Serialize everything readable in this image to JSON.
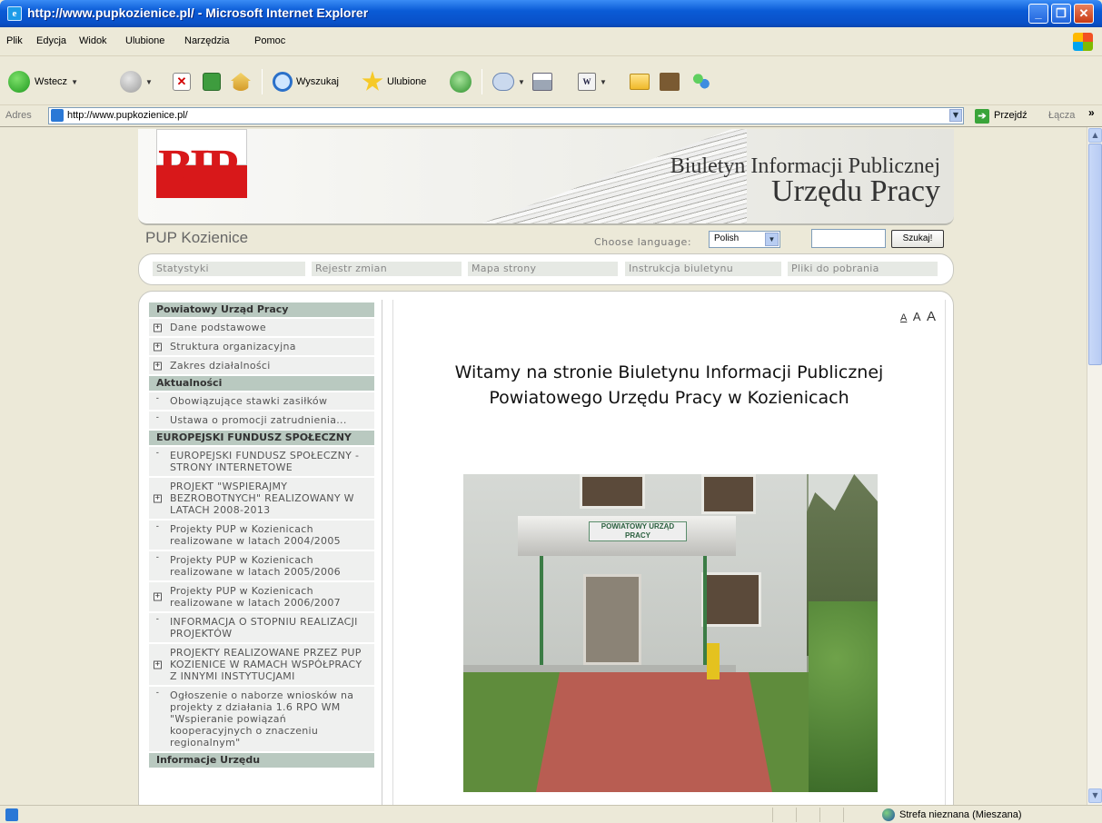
{
  "window": {
    "title": "http://www.pupkozienice.pl/ - Microsoft Internet Explorer",
    "app_icon": "ie-page-icon",
    "controls": [
      "minimize",
      "maximize",
      "close"
    ]
  },
  "menu": [
    "Plik",
    "Edycja",
    "Widok",
    "Ulubione",
    "Narzędzia",
    "Pomoc"
  ],
  "toolbar": {
    "back": "Wstecz",
    "search": "Wyszukaj",
    "favorites": "Ulubione"
  },
  "address": {
    "label": "Adres",
    "url": "http://www.pupkozienice.pl/",
    "go": "Przejdź",
    "links": "Łącza",
    "more": "»"
  },
  "banner": {
    "logo": "BIP",
    "line1": "Biuletyn Informacji Publicznej",
    "line2": "Urzędu Pracy"
  },
  "header": {
    "site_name": "PUP Kozienice",
    "language_label": "Choose language:",
    "language_value": "Polish",
    "search_value": "",
    "search_button": "Szukaj!"
  },
  "topnav": [
    "Statystyki",
    "Rejestr zmian",
    "Mapa strony",
    "Instrukcja biuletynu",
    "Pliki do pobrania"
  ],
  "sidebar": {
    "sections": [
      {
        "title": "Powiatowy Urząd Pracy",
        "items": [
          {
            "label": "Dane podstawowe",
            "mark": "plus"
          },
          {
            "label": "Struktura organizacyjna",
            "mark": "plus"
          },
          {
            "label": "Zakres działalności",
            "mark": "plus"
          }
        ]
      },
      {
        "title": "Aktualności",
        "items": [
          {
            "label": "Obowiązujące stawki zasiłków",
            "mark": "minus"
          },
          {
            "label": "Ustawa o promocji zatrudnienia...",
            "mark": "minus"
          }
        ]
      },
      {
        "title": "EUROPEJSKI FUNDUSZ SPOŁECZNY",
        "items": [
          {
            "label": "EUROPEJSKI FUNDUSZ SPOŁECZNY - STRONY INTERNETOWE",
            "mark": "minus"
          },
          {
            "label": "PROJEKT \"WSPIERAJMY BEZROBOTNYCH\" REALIZOWANY W LATACH 2008-2013",
            "mark": "plus"
          },
          {
            "label": "Projekty PUP w Kozienicach realizowane w latach 2004/2005",
            "mark": "minus"
          },
          {
            "label": "Projekty PUP w Kozienicach realizowane w latach 2005/2006",
            "mark": "minus"
          },
          {
            "label": "Projekty PUP w Kozienicach realizowane w latach 2006/2007",
            "mark": "plus"
          },
          {
            "label": "INFORMACJA O STOPNIU REALIZACJI PROJEKTÓW",
            "mark": "minus"
          },
          {
            "label": "PROJEKTY REALIZOWANE PRZEZ PUP KOZIENICE W RAMACH WSPÓŁPRACY Z INNYMI INSTYTUCJAMI",
            "mark": "plus"
          },
          {
            "label": "Ogłoszenie o naborze wniosków na projekty z działania 1.6 RPO WM \"Wspieranie powiązań kooperacyjnych o znaczeniu regionalnym\"",
            "mark": "minus"
          }
        ]
      },
      {
        "title": "Informacje Urzędu",
        "items": []
      }
    ]
  },
  "main": {
    "font_size_links": [
      "A",
      "A",
      "A"
    ],
    "welcome_line1": "Witamy na stronie Biuletynu Informacji Publicznej",
    "welcome_line2": "Powiatowego Urzędu Pracy w Kozienicach",
    "photo_sign": "POWIATOWY URZĄD PRACY"
  },
  "status": {
    "zone": "Strefa nieznana (Mieszana)"
  }
}
